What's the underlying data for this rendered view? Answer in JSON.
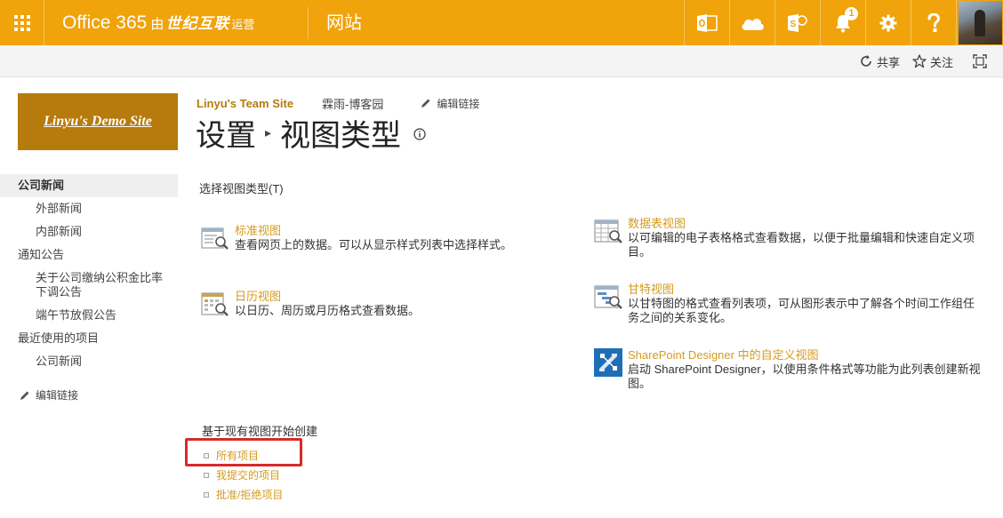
{
  "suitebar": {
    "brand": "Office 365",
    "brand_by": "由",
    "brand_partner": "世纪互联",
    "brand_op": "运营",
    "app_name": "网站",
    "notification_count": "1",
    "colors": {
      "bar": "#f0a30a",
      "accent": "#d59b20",
      "logo_bg": "#b67a0d",
      "highlight": "#d62b2b"
    }
  },
  "ribbon": {
    "share_label": "共享",
    "follow_label": "关注"
  },
  "site_logo": {
    "text": "Linyu's Demo Site"
  },
  "leftnav": {
    "items": [
      {
        "label": "公司新闻"
      },
      {
        "label": "外部新闻"
      },
      {
        "label": "内部新闻"
      },
      {
        "label": "通知公告"
      },
      {
        "label": "关于公司缴纳公积金比率下调公告"
      },
      {
        "label": "端午节放假公告"
      },
      {
        "label": "最近使用的项目"
      },
      {
        "label": "公司新闻"
      }
    ],
    "edit_links": "编辑链接"
  },
  "header": {
    "site_name": "Linyu's Team Site",
    "blog_link": "霖雨-博客园",
    "edit_links": "编辑链接",
    "title_part1": "设置",
    "title_sep": "▸",
    "title_part2": "视图类型"
  },
  "main": {
    "choose_label": "选择视图类型(T)",
    "view_types": [
      {
        "title": "标准视图",
        "desc": "查看网页上的数据。可以从显示样式列表中选择样式。"
      },
      {
        "title": "数据表视图",
        "desc": "以可编辑的电子表格格式查看数据，以便于批量编辑和快速自定义项目。"
      },
      {
        "title": "日历视图",
        "desc": "以日历、周历或月历格式查看数据。"
      },
      {
        "title": "甘特视图",
        "desc": "以甘特图的格式查看列表项，可从图形表示中了解各个时间工作组任务之间的关系变化。"
      },
      {
        "title": "SharePoint Designer 中的自定义视图",
        "desc": "启动 SharePoint Designer，以使用条件格式等功能为此列表创建新视图。"
      }
    ],
    "existing_label": "基于现有视图开始创建",
    "existing_views": [
      {
        "label": "所有项目"
      },
      {
        "label": "我提交的项目"
      },
      {
        "label": "批准/拒绝项目"
      }
    ]
  }
}
